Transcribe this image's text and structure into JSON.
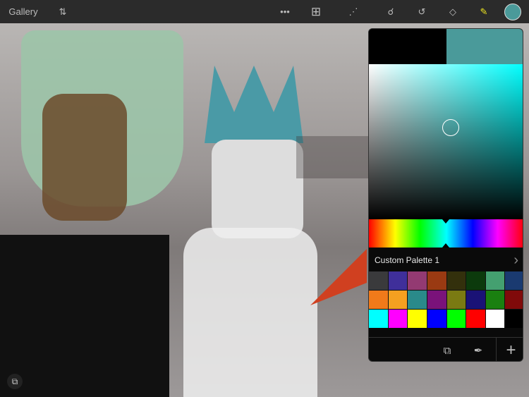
{
  "toolbar": {
    "gallery": "Gallery",
    "adjust_icon": "adjustments-icon",
    "more_icon": "more-icon",
    "transform_icon": "transform-icon",
    "selection_icon": "selection-icon",
    "smudge_icon": "smudge-icon",
    "lasso_icon": "lasso-icon",
    "eraser_icon": "eraser-icon",
    "brush_icon": "brush-icon",
    "current_color": "#4a9a9a"
  },
  "color_panel": {
    "previous_color": "#000000",
    "current_color": "#4a9a9a",
    "hue_color": "#00ffff",
    "palette_title": "Custom Palette 1",
    "swatches": [
      "#3a3a3c",
      "#3f2f9a",
      "#933a72",
      "#9a3a12",
      "#33300c",
      "#0c3a0c",
      "#44a070",
      "#1a3a70",
      "#f07a1a",
      "#f5a020",
      "#2a8a8a",
      "#7a127a",
      "#7a7a12",
      "#1a1276",
      "#1a8010",
      "#800a0a",
      "#00ffff",
      "#ff00ff",
      "#ffff00",
      "#0000ff",
      "#00ff00",
      "#ff0000",
      "#ffffff",
      "#000000"
    ],
    "buttons": {
      "camera": "camera-add-icon",
      "eyedropper": "eyedropper-icon",
      "add": "+"
    }
  }
}
